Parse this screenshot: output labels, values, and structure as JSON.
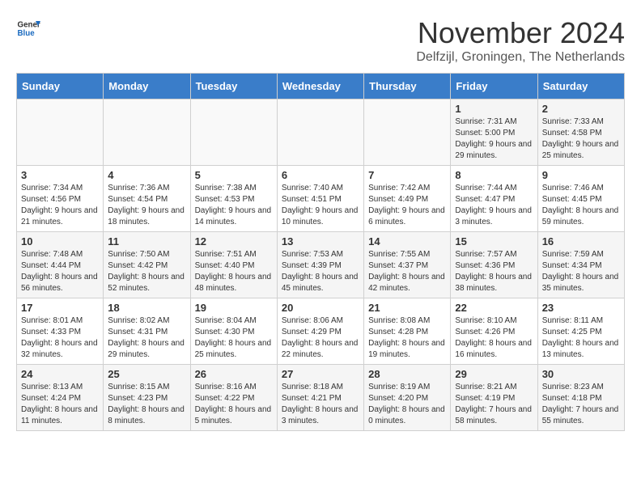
{
  "logo": {
    "general": "General",
    "blue": "Blue"
  },
  "title": "November 2024",
  "subtitle": "Delfzijl, Groningen, The Netherlands",
  "days_of_week": [
    "Sunday",
    "Monday",
    "Tuesday",
    "Wednesday",
    "Thursday",
    "Friday",
    "Saturday"
  ],
  "weeks": [
    [
      {
        "day": "",
        "info": ""
      },
      {
        "day": "",
        "info": ""
      },
      {
        "day": "",
        "info": ""
      },
      {
        "day": "",
        "info": ""
      },
      {
        "day": "",
        "info": ""
      },
      {
        "day": "1",
        "info": "Sunrise: 7:31 AM\nSunset: 5:00 PM\nDaylight: 9 hours and 29 minutes."
      },
      {
        "day": "2",
        "info": "Sunrise: 7:33 AM\nSunset: 4:58 PM\nDaylight: 9 hours and 25 minutes."
      }
    ],
    [
      {
        "day": "3",
        "info": "Sunrise: 7:34 AM\nSunset: 4:56 PM\nDaylight: 9 hours and 21 minutes."
      },
      {
        "day": "4",
        "info": "Sunrise: 7:36 AM\nSunset: 4:54 PM\nDaylight: 9 hours and 18 minutes."
      },
      {
        "day": "5",
        "info": "Sunrise: 7:38 AM\nSunset: 4:53 PM\nDaylight: 9 hours and 14 minutes."
      },
      {
        "day": "6",
        "info": "Sunrise: 7:40 AM\nSunset: 4:51 PM\nDaylight: 9 hours and 10 minutes."
      },
      {
        "day": "7",
        "info": "Sunrise: 7:42 AM\nSunset: 4:49 PM\nDaylight: 9 hours and 6 minutes."
      },
      {
        "day": "8",
        "info": "Sunrise: 7:44 AM\nSunset: 4:47 PM\nDaylight: 9 hours and 3 minutes."
      },
      {
        "day": "9",
        "info": "Sunrise: 7:46 AM\nSunset: 4:45 PM\nDaylight: 8 hours and 59 minutes."
      }
    ],
    [
      {
        "day": "10",
        "info": "Sunrise: 7:48 AM\nSunset: 4:44 PM\nDaylight: 8 hours and 56 minutes."
      },
      {
        "day": "11",
        "info": "Sunrise: 7:50 AM\nSunset: 4:42 PM\nDaylight: 8 hours and 52 minutes."
      },
      {
        "day": "12",
        "info": "Sunrise: 7:51 AM\nSunset: 4:40 PM\nDaylight: 8 hours and 48 minutes."
      },
      {
        "day": "13",
        "info": "Sunrise: 7:53 AM\nSunset: 4:39 PM\nDaylight: 8 hours and 45 minutes."
      },
      {
        "day": "14",
        "info": "Sunrise: 7:55 AM\nSunset: 4:37 PM\nDaylight: 8 hours and 42 minutes."
      },
      {
        "day": "15",
        "info": "Sunrise: 7:57 AM\nSunset: 4:36 PM\nDaylight: 8 hours and 38 minutes."
      },
      {
        "day": "16",
        "info": "Sunrise: 7:59 AM\nSunset: 4:34 PM\nDaylight: 8 hours and 35 minutes."
      }
    ],
    [
      {
        "day": "17",
        "info": "Sunrise: 8:01 AM\nSunset: 4:33 PM\nDaylight: 8 hours and 32 minutes."
      },
      {
        "day": "18",
        "info": "Sunrise: 8:02 AM\nSunset: 4:31 PM\nDaylight: 8 hours and 29 minutes."
      },
      {
        "day": "19",
        "info": "Sunrise: 8:04 AM\nSunset: 4:30 PM\nDaylight: 8 hours and 25 minutes."
      },
      {
        "day": "20",
        "info": "Sunrise: 8:06 AM\nSunset: 4:29 PM\nDaylight: 8 hours and 22 minutes."
      },
      {
        "day": "21",
        "info": "Sunrise: 8:08 AM\nSunset: 4:28 PM\nDaylight: 8 hours and 19 minutes."
      },
      {
        "day": "22",
        "info": "Sunrise: 8:10 AM\nSunset: 4:26 PM\nDaylight: 8 hours and 16 minutes."
      },
      {
        "day": "23",
        "info": "Sunrise: 8:11 AM\nSunset: 4:25 PM\nDaylight: 8 hours and 13 minutes."
      }
    ],
    [
      {
        "day": "24",
        "info": "Sunrise: 8:13 AM\nSunset: 4:24 PM\nDaylight: 8 hours and 11 minutes."
      },
      {
        "day": "25",
        "info": "Sunrise: 8:15 AM\nSunset: 4:23 PM\nDaylight: 8 hours and 8 minutes."
      },
      {
        "day": "26",
        "info": "Sunrise: 8:16 AM\nSunset: 4:22 PM\nDaylight: 8 hours and 5 minutes."
      },
      {
        "day": "27",
        "info": "Sunrise: 8:18 AM\nSunset: 4:21 PM\nDaylight: 8 hours and 3 minutes."
      },
      {
        "day": "28",
        "info": "Sunrise: 8:19 AM\nSunset: 4:20 PM\nDaylight: 8 hours and 0 minutes."
      },
      {
        "day": "29",
        "info": "Sunrise: 8:21 AM\nSunset: 4:19 PM\nDaylight: 7 hours and 58 minutes."
      },
      {
        "day": "30",
        "info": "Sunrise: 8:23 AM\nSunset: 4:18 PM\nDaylight: 7 hours and 55 minutes."
      }
    ]
  ]
}
